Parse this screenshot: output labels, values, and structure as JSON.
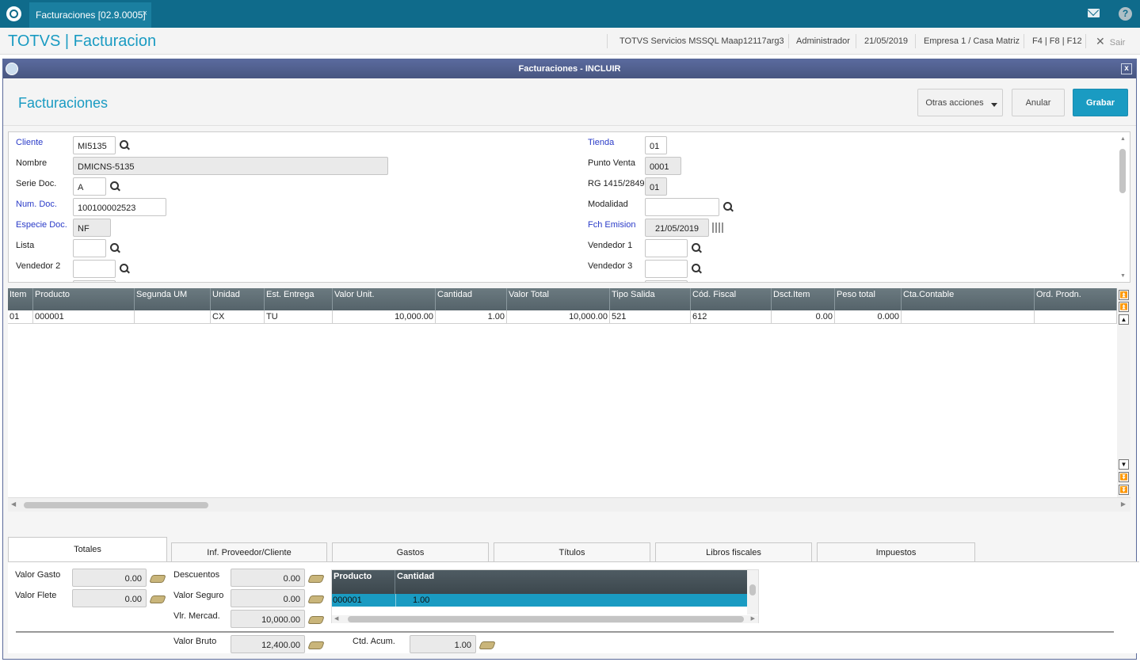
{
  "topbar": {
    "tab_label": "Facturaciones [02.9.0005]",
    "tab_close": "×"
  },
  "appbar": {
    "title": "TOTVS | Facturacion",
    "environment": "TOTVS Servicios MSSQL Maap12117arg3",
    "user": "Administrador",
    "date": "21/05/2019",
    "company": "Empresa 1 / Casa Matriz",
    "shortcuts": "F4 | F8 | F12",
    "exit_label": "Sair"
  },
  "window": {
    "title": "Facturaciones - INCLUIR",
    "close": "x"
  },
  "header": {
    "title": "Facturaciones",
    "other_actions": "Otras acciones",
    "cancel": "Anular",
    "save": "Grabar"
  },
  "form": {
    "cliente_label": "Cliente",
    "cliente": "MI5135",
    "nombre_label": "Nombre",
    "nombre": "DMICNS-5135",
    "serie_label": "Serie Doc.",
    "serie": "A",
    "numdoc_label": "Num. Doc.",
    "numdoc": "100100002523",
    "especie_label": "Especie Doc.",
    "especie": "NF",
    "lista_label": "Lista",
    "lista": "",
    "vendedor2_label": "Vendedor 2",
    "vendedor2": "",
    "tienda_label": "Tienda",
    "tienda": "01",
    "punto_label": "Punto Venta",
    "punto": "0001",
    "rg_label": "RG 1415/2849",
    "rg": "01",
    "modalidad_label": "Modalidad",
    "modalidad": "",
    "fch_label": "Fch Emision",
    "fch": "21/05/2019",
    "vendedor1_label": "Vendedor 1",
    "vendedor1": "",
    "vendedor3_label": "Vendedor 3",
    "vendedor3": ""
  },
  "grid": {
    "columns": [
      "Item",
      "Producto",
      "Segunda UM",
      "Unidad",
      "Est. Entrega",
      "Valor Unit.",
      "Cantidad",
      "Valor Total",
      "Tipo Salida",
      "Cód. Fiscal",
      "Dsct.Item",
      "Peso total",
      "Cta.Contable",
      "Ord. Prodn."
    ],
    "rows": [
      [
        "01",
        "000001",
        "",
        "CX",
        "TU",
        "10,000.00",
        "1.00",
        "10,000.00",
        "521",
        "612",
        "0.00",
        "0.000",
        "",
        ""
      ]
    ]
  },
  "tabs": [
    "Totales",
    "Inf. Proveedor/Cliente",
    "Gastos",
    "Títulos",
    "Libros fiscales",
    "Impuestos"
  ],
  "totals": {
    "valor_gasto_label": "Valor Gasto",
    "valor_gasto": "0.00",
    "valor_flete_label": "Valor Flete",
    "valor_flete": "0.00",
    "descuentos_label": "Descuentos",
    "descuentos": "0.00",
    "valor_seguro_label": "Valor Seguro",
    "valor_seguro": "0.00",
    "vlr_mercad_label": "Vlr. Mercad.",
    "vlr_mercad": "10,000.00",
    "valor_bruto_label": "Valor Bruto",
    "valor_bruto": "12,400.00",
    "ctd_acum_label": "Ctd. Acum.",
    "ctd_acum": "1.00"
  },
  "mini_grid": {
    "columns": [
      "Producto",
      "Cantidad"
    ],
    "row": [
      "000001",
      "1.00"
    ]
  },
  "colors": {
    "brand": "#0f6b8b",
    "accent": "#1a9bc2",
    "window_title": "#485680"
  }
}
